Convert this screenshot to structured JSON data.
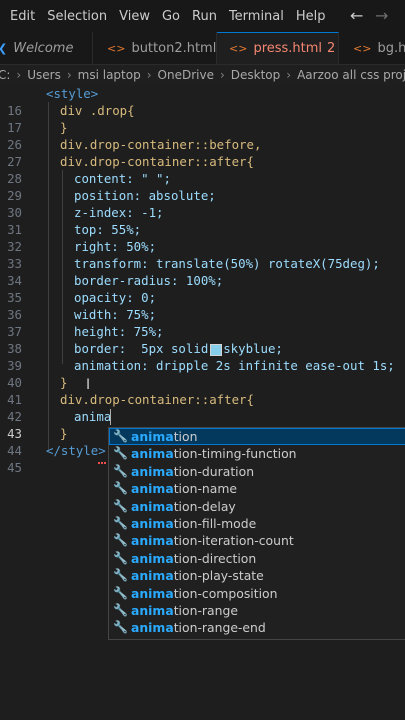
{
  "menu": {
    "items": [
      "Edit",
      "Selection",
      "View",
      "Go",
      "Run",
      "Terminal",
      "Help"
    ]
  },
  "tabs": [
    {
      "label": "Welcome",
      "icon": "vscode-logo-icon",
      "active": false
    },
    {
      "label": "button2.html",
      "icon": "html-file-icon",
      "active": false
    },
    {
      "label": "press.html",
      "badge": "2",
      "icon": "html-file-icon",
      "active": true,
      "modified": true
    },
    {
      "label": "bg.html",
      "icon": "html-file-icon",
      "active": false
    }
  ],
  "breadcrumb": [
    "C:",
    "Users",
    "msi laptop",
    "OneDrive",
    "Desktop",
    "Aarzoo all css project"
  ],
  "editor": {
    "lines": [
      {
        "n": "16",
        "text": "<style>"
      },
      {
        "n": "17",
        "text": "div .drop{"
      },
      {
        "n": "26",
        "text": "}"
      },
      {
        "n": "27",
        "text": "div.drop-container::before,"
      },
      {
        "n": "28",
        "text": "div.drop-container::after{"
      },
      {
        "n": "29",
        "text": "content: \" \";"
      },
      {
        "n": "30",
        "text": "position: absolute;"
      },
      {
        "n": "31",
        "text": "z-index: -1;"
      },
      {
        "n": "32",
        "text": "top: 55%;"
      },
      {
        "n": "33",
        "text": "right: 50%;"
      },
      {
        "n": "34",
        "text": "transform: translate(50%) rotateX(75deg);"
      },
      {
        "n": "35",
        "text": "border-radius: 100%;"
      },
      {
        "n": "36",
        "text": "opacity: 0;"
      },
      {
        "n": "37",
        "text": "width: 75%;"
      },
      {
        "n": "38",
        "text": "height: 75%;"
      },
      {
        "n": "39",
        "text": "border:  5px solid  skyblue;"
      },
      {
        "n": "40",
        "text": "animation: dripple 2s infinite ease-out 1s;"
      },
      {
        "n": "41",
        "text": "}"
      },
      {
        "n": "42",
        "text": "div.drop-container::after{"
      },
      {
        "n": "43",
        "text": "anima"
      },
      {
        "n": "44",
        "text": "}"
      },
      {
        "n": "45",
        "text": "</style>"
      }
    ],
    "swatch_color": "#87ceeb"
  },
  "suggestions": {
    "typed": "anima",
    "items": [
      {
        "match": "anima",
        "rest": "tion"
      },
      {
        "match": "anima",
        "rest": "tion-timing-function"
      },
      {
        "match": "anima",
        "rest": "tion-duration"
      },
      {
        "match": "anima",
        "rest": "tion-name"
      },
      {
        "match": "anima",
        "rest": "tion-delay"
      },
      {
        "match": "anima",
        "rest": "tion-fill-mode"
      },
      {
        "match": "anima",
        "rest": "tion-iteration-count"
      },
      {
        "match": "anima",
        "rest": "tion-direction"
      },
      {
        "match": "anima",
        "rest": "tion-play-state"
      },
      {
        "match": "anima",
        "rest": "tion-composition"
      },
      {
        "match": "anima",
        "rest": "tion-range"
      },
      {
        "match": "anima",
        "rest": "tion-range-end"
      }
    ]
  },
  "colors": {
    "accent": "#0078d4",
    "match": "#2aaaff",
    "modified_tab": "#f48771"
  }
}
